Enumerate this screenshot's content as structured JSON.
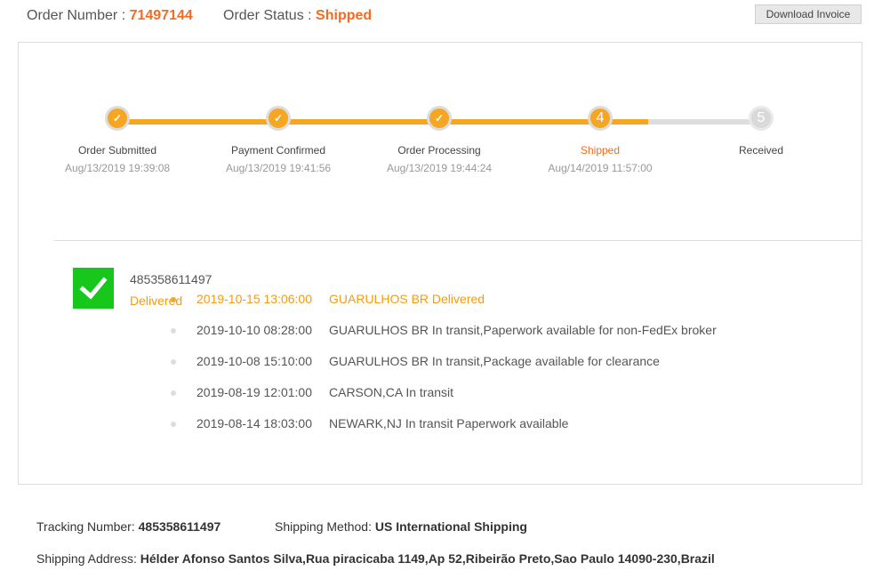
{
  "header": {
    "order_number_label": "Order Number : ",
    "order_number": "71497144",
    "order_status_label": "Order Status : ",
    "order_status": "Shipped",
    "download_invoice": "Download Invoice"
  },
  "progress": {
    "completed_fraction": 0.825,
    "steps": [
      {
        "label": "Order Submitted",
        "date": "Aug/13/2019 19:39:08",
        "state": "done",
        "marker": "✓"
      },
      {
        "label": "Payment Confirmed",
        "date": "Aug/13/2019 19:41:56",
        "state": "done",
        "marker": "✓"
      },
      {
        "label": "Order Processing",
        "date": "Aug/13/2019 19:44:24",
        "state": "done",
        "marker": "✓"
      },
      {
        "label": "Shipped",
        "date": "Aug/14/2019 11:57:00",
        "state": "current",
        "marker": "4"
      },
      {
        "label": "Received",
        "date": "",
        "state": "pending",
        "marker": "5"
      }
    ]
  },
  "shipment": {
    "tracking_number": "485358611497",
    "status": "Delivered",
    "events": [
      {
        "time": "2019-10-15 13:06:00",
        "description": "GUARULHOS BR Delivered",
        "latest": true
      },
      {
        "time": "2019-10-10 08:28:00",
        "description": "GUARULHOS BR In transit,Paperwork available for non-FedEx broker",
        "latest": false
      },
      {
        "time": "2019-10-08 15:10:00",
        "description": "GUARULHOS BR In transit,Package available for clearance",
        "latest": false
      },
      {
        "time": "2019-08-19 12:01:00",
        "description": "CARSON,CA In transit",
        "latest": false
      },
      {
        "time": "2019-08-14 18:03:00",
        "description": "NEWARK,NJ In transit Paperwork available",
        "latest": false
      }
    ]
  },
  "details": {
    "tracking_label": "Tracking Number: ",
    "tracking_value": "485358611497",
    "method_label": "Shipping Method: ",
    "method_value": "US International Shipping",
    "address_label": "Shipping Address: ",
    "address_value": "Hélder Afonso Santos Silva,Rua piracicaba 1149,Ap 52,Ribeirão Preto,Sao Paulo 14090-230,Brazil"
  },
  "colors": {
    "accent": "#f36c21",
    "progress": "#f5a623",
    "delivered_check": "#18c71b"
  }
}
